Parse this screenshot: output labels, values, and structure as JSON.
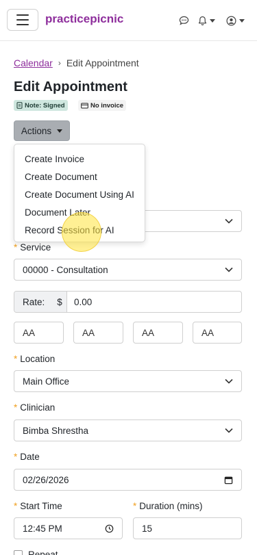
{
  "header": {
    "brand": "practicepicnic",
    "menu_icon": "hamburger-icon",
    "chat_icon": "chat-icon",
    "bell_icon": "bell-icon",
    "user_icon": "user-circle-icon"
  },
  "breadcrumb": {
    "parent": "Calendar",
    "separator": "›",
    "current": "Edit Appointment"
  },
  "page": {
    "title": "Edit Appointment"
  },
  "badges": {
    "note": "Note: Signed",
    "invoice": "No invoice"
  },
  "actions": {
    "label": "Actions",
    "menu": [
      "Create Invoice",
      "Create Document",
      "Create Document Using AI",
      "Document Later",
      "Record Session for AI"
    ]
  },
  "form": {
    "service": {
      "label": "Service",
      "value": "00000 - Consultation"
    },
    "rate": {
      "label": "Rate:",
      "currency": "$",
      "value": "0.00"
    },
    "modifiers": [
      "AA",
      "AA",
      "AA",
      "AA"
    ],
    "location": {
      "label": "Location",
      "value": "Main Office"
    },
    "clinician": {
      "label": "Clinician",
      "value": "Bimba Shrestha"
    },
    "date": {
      "label": "Date",
      "value": "02/26/2026"
    },
    "start_time": {
      "label": "Start Time",
      "value": "12:45 PM"
    },
    "duration": {
      "label": "Duration (mins)",
      "value": "15"
    },
    "repeat": {
      "label": "Repeat"
    }
  },
  "colors": {
    "brand": "#8e2e9c",
    "required": "#f0a020",
    "note_badge_bg": "#cfe7df"
  }
}
